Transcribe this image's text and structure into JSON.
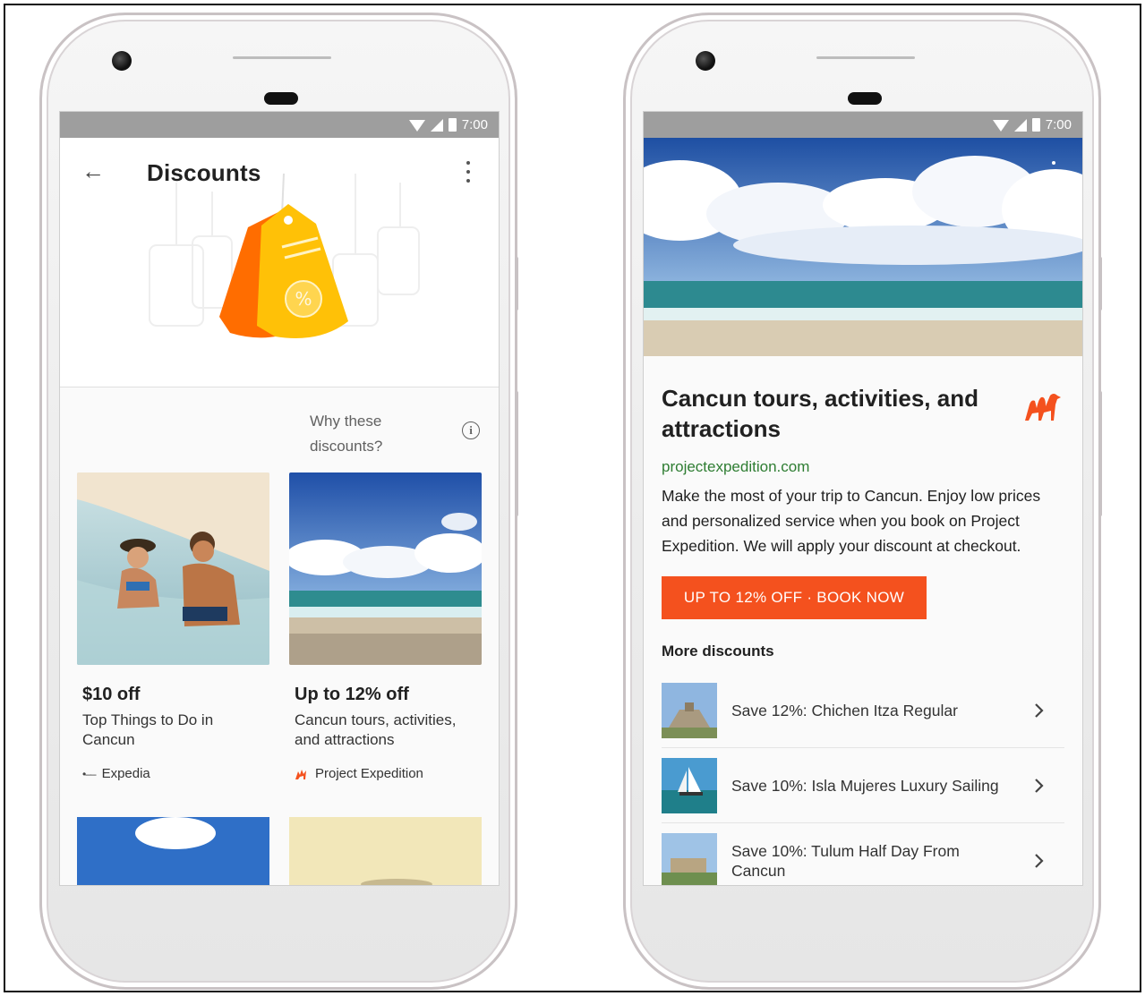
{
  "status_bar": {
    "time": "7:00"
  },
  "left_screen": {
    "title": "Discounts",
    "why_text": "Why these discounts?",
    "info_icon": "i",
    "cards": [
      {
        "title": "$10 off",
        "description": "Top Things to Do in Cancun",
        "source": "Expedia",
        "source_icon": "expedia-logo"
      },
      {
        "title": "Up to 12% off",
        "description": "Cancun tours, activities, and attractions",
        "source": "Project Expedition",
        "source_icon": "camel-icon"
      }
    ]
  },
  "right_screen": {
    "title": "Cancun tours, activities, and attractions",
    "url": "projectexpedition.com",
    "description": "Make the most of your trip to Cancun. Enjoy low prices and personalized service when you book on Project Expedition. We will apply your discount at checkout.",
    "button_label": "UP TO 12% OFF · BOOK NOW",
    "more_label": "More discounts",
    "more_items": [
      {
        "label": "Save 12%: Chichen Itza Regular"
      },
      {
        "label": "Save 10%: Isla Mujeres Luxury Sailing"
      },
      {
        "label": "Save 10%: Tulum Half Day From Cancun"
      }
    ]
  },
  "colors": {
    "accent": "#f4511e",
    "url_green": "#2e7d32",
    "status_bar": "#9e9e9e"
  }
}
